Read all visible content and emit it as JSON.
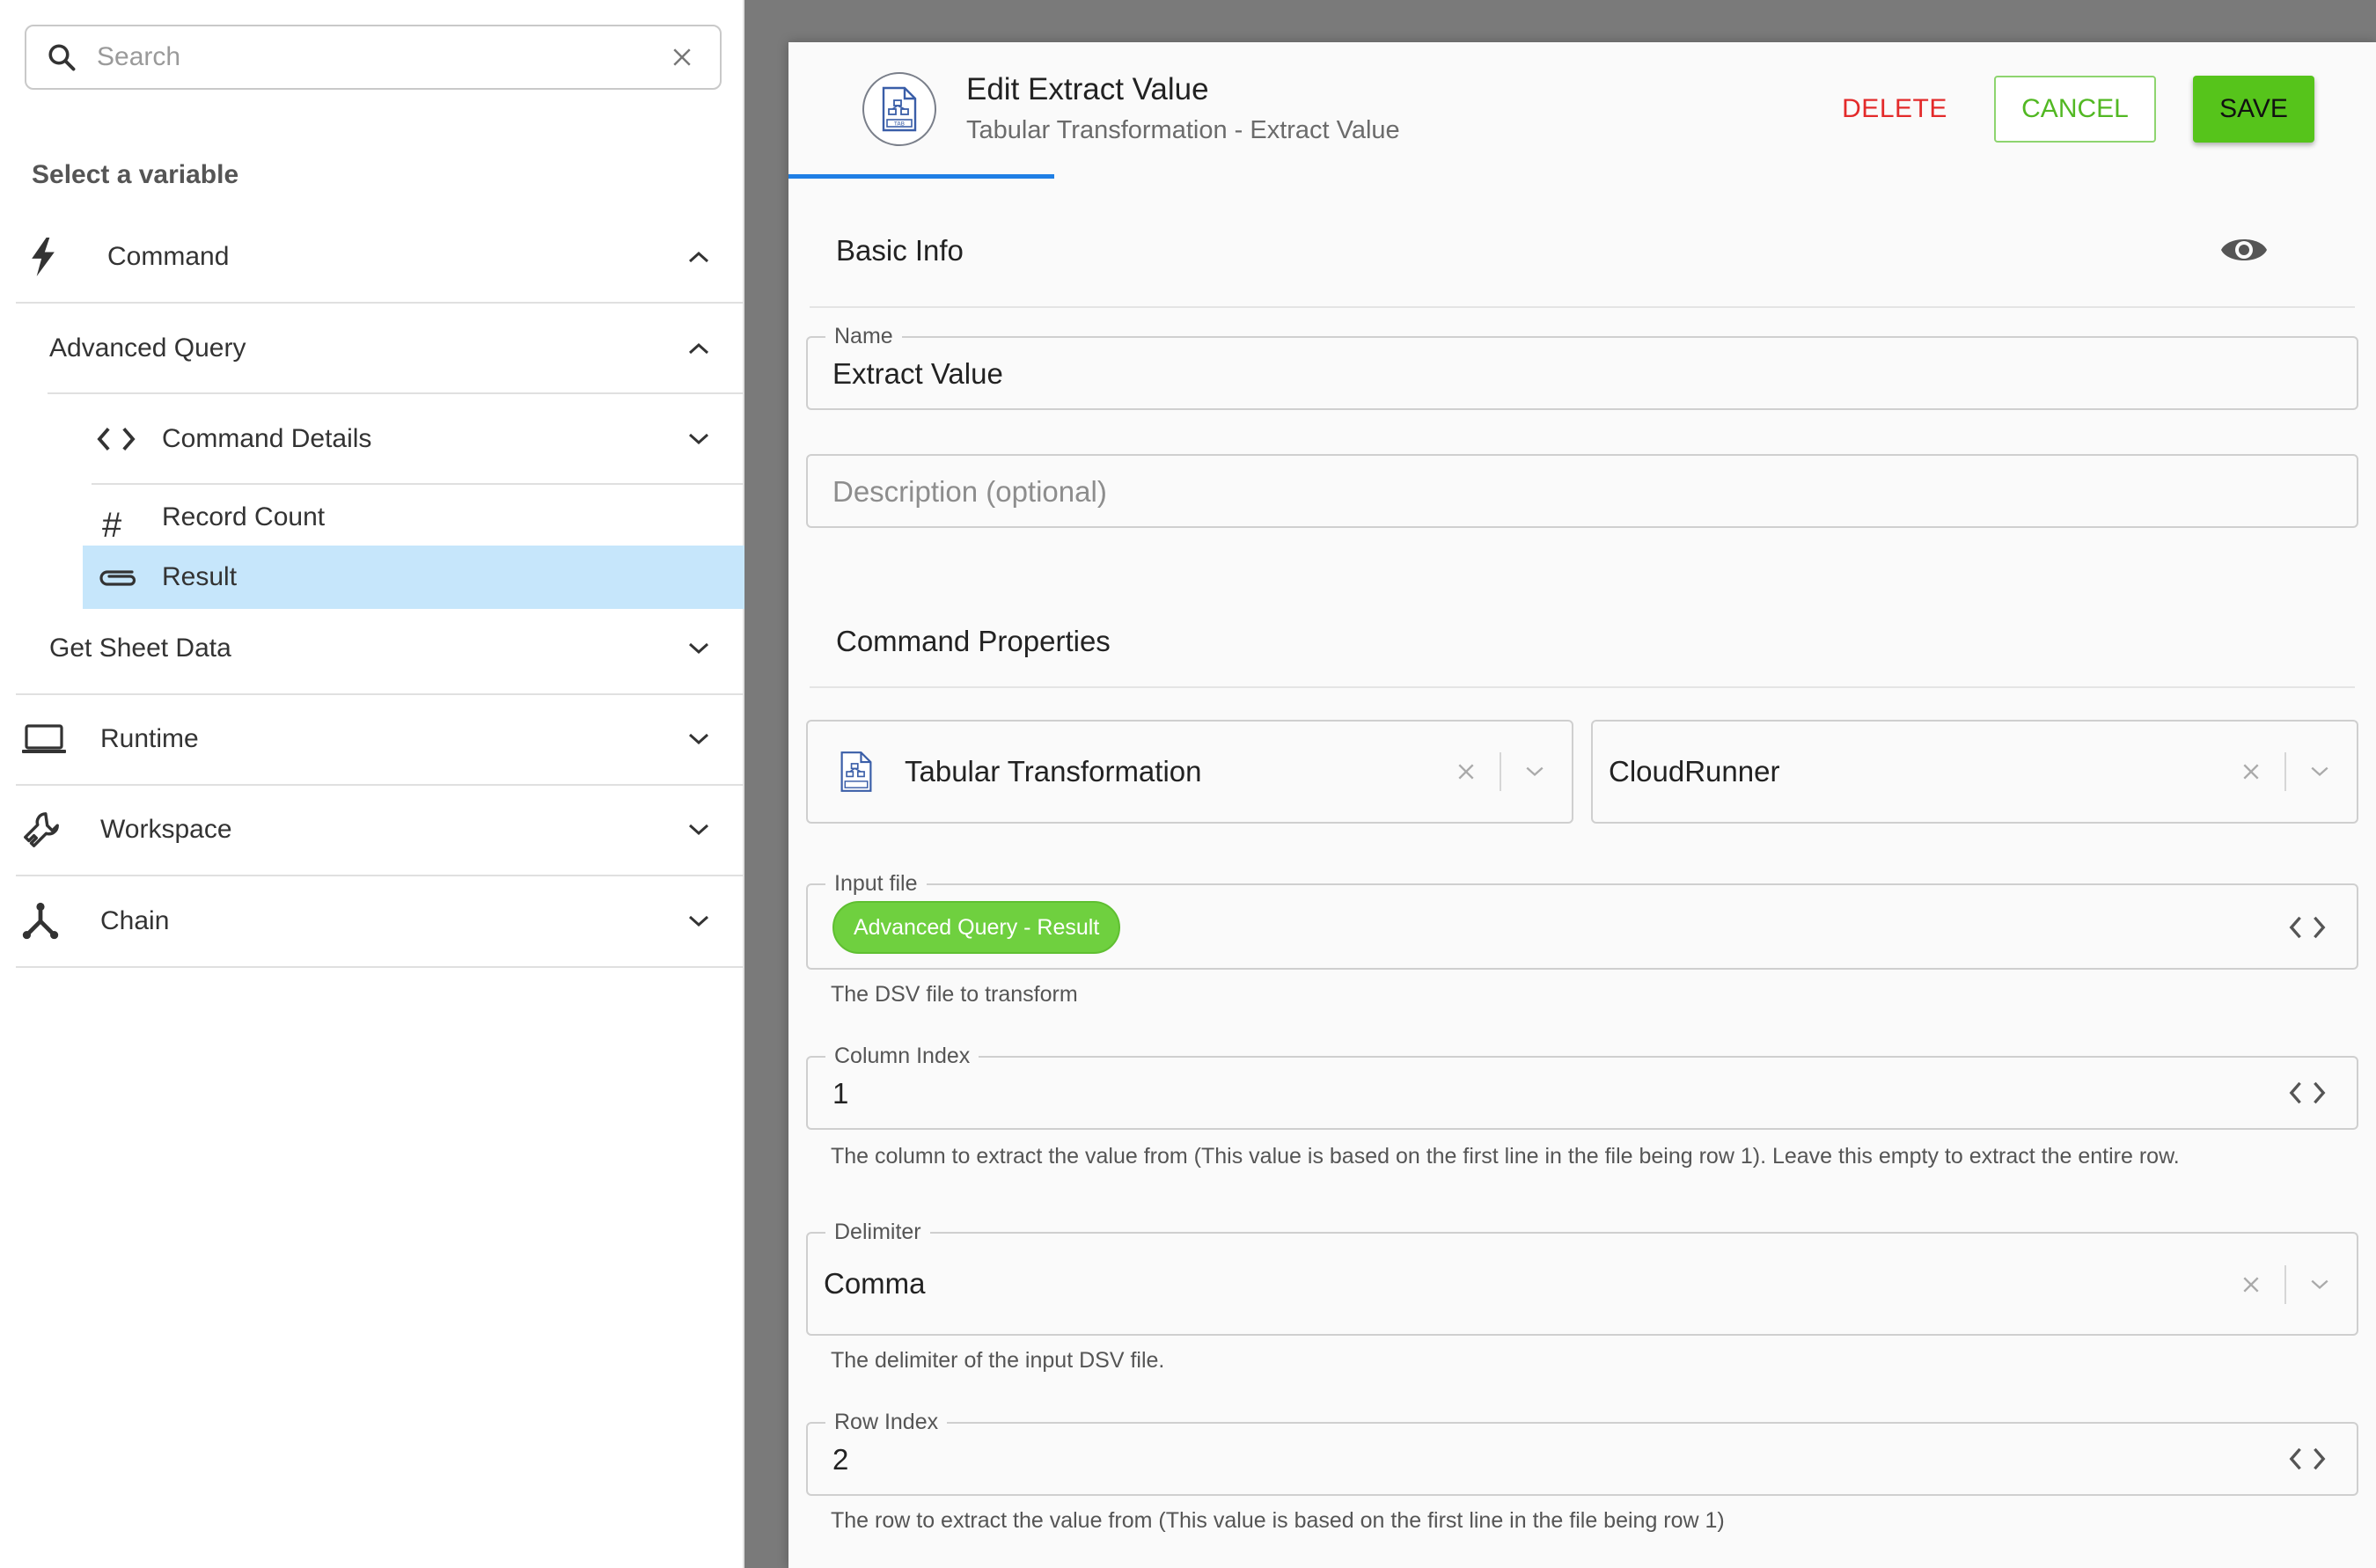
{
  "sidebar": {
    "search": {
      "placeholder": "Search"
    },
    "heading": "Select a variable",
    "items": {
      "command": "Command",
      "advanced_query": "Advanced Query",
      "command_details": "Command Details",
      "record_count": "Record Count",
      "result": "Result",
      "get_sheet_data": "Get Sheet Data",
      "runtime": "Runtime",
      "workspace": "Workspace",
      "chain": "Chain"
    },
    "selected": "Result"
  },
  "dialog": {
    "title": "Edit Extract Value",
    "subtitle": "Tabular Transformation - Extract Value",
    "buttons": {
      "delete": "DELETE",
      "cancel": "CANCEL",
      "save": "SAVE"
    },
    "logo_text": "TAB",
    "basic_info": {
      "title": "Basic Info",
      "name_label": "Name",
      "name_value": "Extract Value",
      "description_placeholder": "Description (optional)"
    },
    "command_properties": {
      "title": "Command Properties",
      "integration": "Tabular Transformation",
      "runner": "CloudRunner",
      "input_file": {
        "label": "Input file",
        "chip": "Advanced Query - Result",
        "helper": "The DSV file to transform"
      },
      "column_index": {
        "label": "Column Index",
        "value": "1",
        "helper": "The column to extract the value from (This value is based on the first line in the file being row 1). Leave this empty to extract the entire row."
      },
      "delimiter": {
        "label": "Delimiter",
        "value": "Comma",
        "helper": "The delimiter of the input DSV file."
      },
      "row_index": {
        "label": "Row Index",
        "value": "2",
        "helper": "The row to extract the value from (This value is based on the first line in the file being row 1)"
      }
    }
  },
  "colors": {
    "accent_blue": "#1f7fe5",
    "save_green": "#56c41b",
    "chip_green": "#6fd03f",
    "delete_red": "#e32a2a",
    "selected_row": "#c6e6fb"
  }
}
